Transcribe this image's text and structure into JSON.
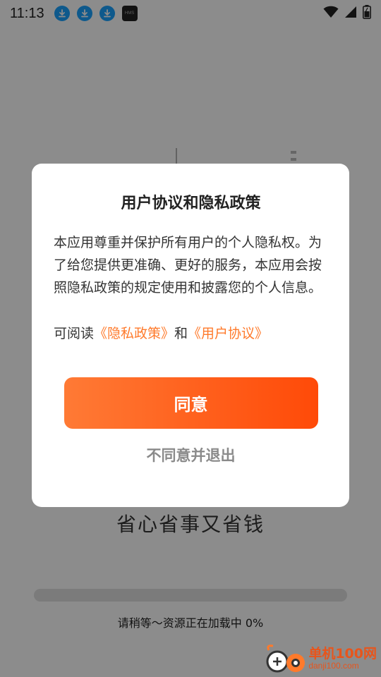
{
  "status_bar": {
    "time": "11:13",
    "notification_icons": [
      "download-icon",
      "download-icon",
      "download-icon",
      "hms-icon"
    ],
    "hms_label": "HMS"
  },
  "background": {
    "slogan": "省心省事又省钱",
    "loading_text": "请稍等～资源正在加载中 0%",
    "progress": 0
  },
  "dialog": {
    "title": "用户协议和隐私政策",
    "body": "本应用尊重并保护所有用户的个人隐私权。为了给您提供更准确、更好的服务，本应用会按照隐私政策的规定使用和披露您的个人信息。",
    "read_prefix": "可阅读",
    "privacy_link": "《隐私政策》",
    "connector": "和",
    "user_agreement_link": "《用户协议》",
    "agree_label": "同意",
    "disagree_label": "不同意并退出"
  },
  "watermark": {
    "title": "单机100网",
    "url": "danji100.com"
  },
  "colors": {
    "accent": "#ff7a2b",
    "button_start": "#ff7a35",
    "button_end": "#ff4a08",
    "overlay": "rgba(0,0,0,0.45)"
  }
}
